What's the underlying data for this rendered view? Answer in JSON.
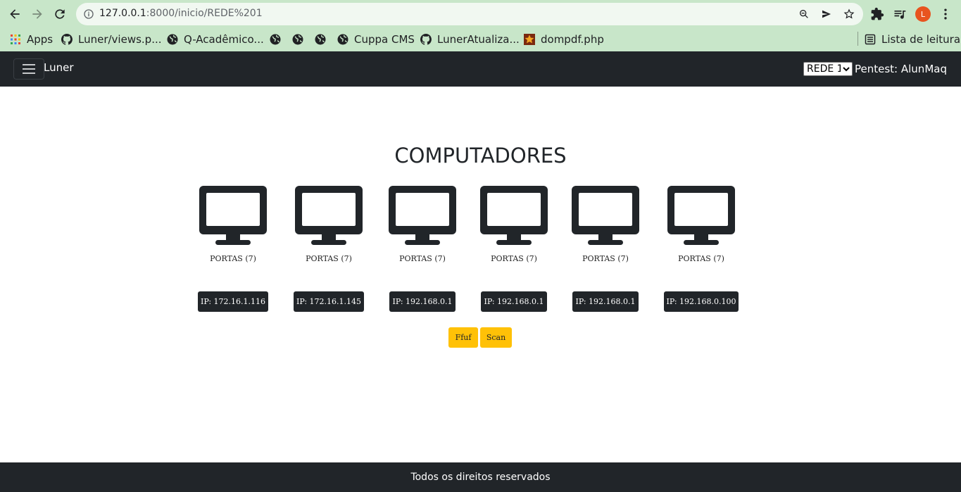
{
  "browser": {
    "url_host": "127.0.0.1",
    "url_rest": ":8000/inicio/REDE%201",
    "profile_initial": "L",
    "bookmarks": [
      {
        "label": "Apps",
        "icon": "apps-grid-icon"
      },
      {
        "label": "Luner/views.p...",
        "icon": "github-icon"
      },
      {
        "label": "Q-Acadêmico...",
        "icon": "globe-icon"
      },
      {
        "label": "",
        "icon": "globe-icon"
      },
      {
        "label": "",
        "icon": "globe-icon"
      },
      {
        "label": "",
        "icon": "globe-icon"
      },
      {
        "label": "Cuppa CMS",
        "icon": "globe-icon"
      },
      {
        "label": "LunerAtualiza...",
        "icon": "github-icon"
      },
      {
        "label": "dompdf.php",
        "icon": "star-bookmark-icon"
      }
    ],
    "reading_list": "Lista de leitura"
  },
  "navbar": {
    "brand": "Luner",
    "network_options": [
      "REDE 1"
    ],
    "network_selected": "REDE 1",
    "pentest_label": "Pentest: AlunMaq"
  },
  "main": {
    "title": "COMPUTADORES",
    "computers": [
      {
        "portas": "PORTAS (7)",
        "ip": "IP: 172.16.1.116"
      },
      {
        "portas": "PORTAS (7)",
        "ip": "IP: 172.16.1.145"
      },
      {
        "portas": "PORTAS (7)",
        "ip": "IP: 192.168.0.1"
      },
      {
        "portas": "PORTAS (7)",
        "ip": "IP: 192.168.0.1"
      },
      {
        "portas": "PORTAS (7)",
        "ip": "IP: 192.168.0.1"
      },
      {
        "portas": "PORTAS (7)",
        "ip": "IP: 192.168.0.100"
      }
    ],
    "buttons": {
      "ffuf": "Ffuf",
      "scan": "Scan"
    }
  },
  "footer": {
    "text": "Todos os direitos reservados"
  },
  "colors": {
    "chrome_bg": "#c8e6c9",
    "navbar_bg": "#212529",
    "warning": "#ffc107",
    "avatar": "#e8541f"
  }
}
